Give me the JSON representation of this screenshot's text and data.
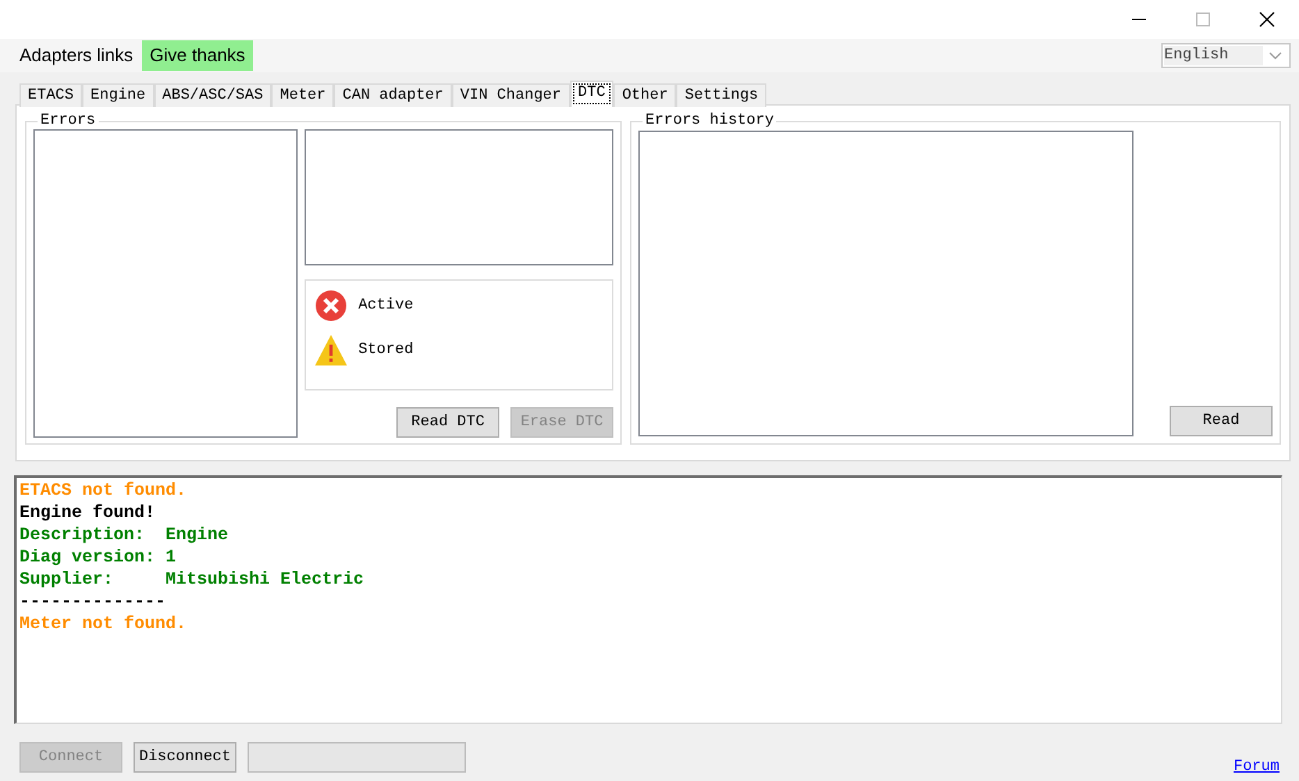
{
  "menu": [
    {
      "label": "Adapters links",
      "highlighted": false
    },
    {
      "label": "Give thanks",
      "highlighted": true
    }
  ],
  "language": {
    "value": "English"
  },
  "tabs": [
    {
      "label": "ETACS",
      "selected": false
    },
    {
      "label": "Engine",
      "selected": false
    },
    {
      "label": "ABS/ASC/SAS",
      "selected": false
    },
    {
      "label": "Meter",
      "selected": false
    },
    {
      "label": "CAN adapter",
      "selected": false
    },
    {
      "label": "VIN Changer",
      "selected": false
    },
    {
      "label": "DTC",
      "selected": true
    },
    {
      "label": "Other",
      "selected": false
    },
    {
      "label": "Settings",
      "selected": false
    }
  ],
  "errors": {
    "title": "Errors",
    "legend": [
      {
        "kind": "active",
        "label": "Active"
      },
      {
        "kind": "stored",
        "label": "Stored"
      }
    ],
    "buttons": [
      {
        "label": "Read DTC",
        "disabled": false
      },
      {
        "label": "Erase DTC",
        "disabled": true
      }
    ]
  },
  "errors_history": {
    "title": "Errors history",
    "buttons": [
      {
        "label": "Read",
        "disabled": false
      }
    ]
  },
  "log": [
    {
      "text": "ETACS not found.",
      "color": "#ff8c00"
    },
    {
      "text": "Engine found!",
      "color": "#000000"
    },
    {
      "text": "Description:  Engine",
      "color": "#008000"
    },
    {
      "text": "Diag version: 1",
      "color": "#008000"
    },
    {
      "text": "Supplier:     Mitsubishi Electric",
      "color": "#008000"
    },
    {
      "text": "--------------",
      "color": "#000000"
    },
    {
      "text": "Meter not found.",
      "color": "#ff8c00"
    }
  ],
  "footer": {
    "buttons": [
      {
        "label": "Connect",
        "disabled": true
      },
      {
        "label": "Disconnect",
        "disabled": false
      }
    ],
    "link": "Forum"
  }
}
